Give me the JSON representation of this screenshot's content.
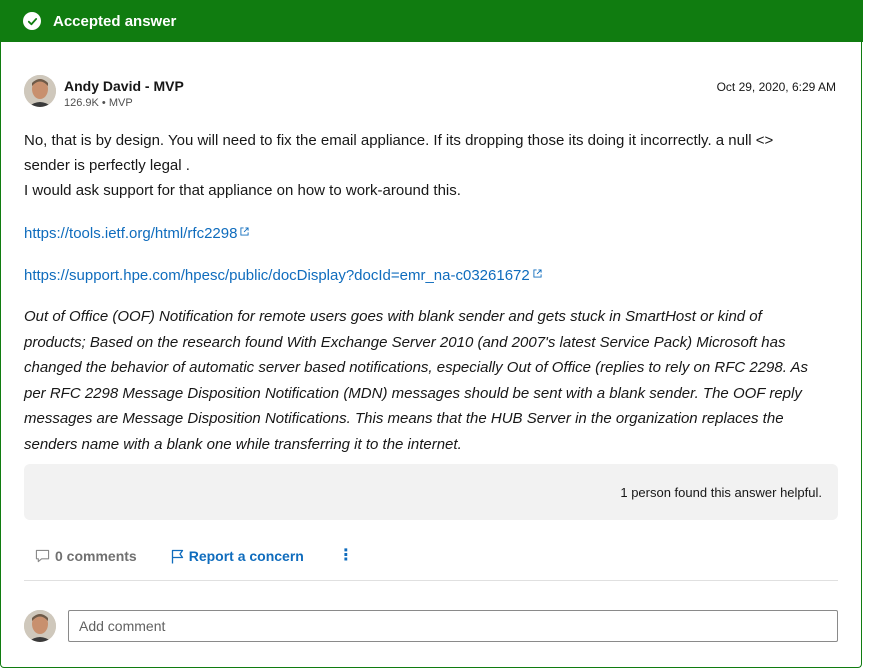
{
  "banner": {
    "title": "Accepted answer"
  },
  "author": {
    "name": "Andy David - MVP",
    "meta": "126.9K • MVP"
  },
  "answer_date": "Oct 29, 2020, 6:29 AM",
  "body": {
    "line1": "No, that is by design. You will need to fix the email appliance. If its dropping those its doing it incorrectly. a null <>",
    "line2": "sender is perfectly legal .",
    "line3": "I would ask support for that appliance on how to work-around this."
  },
  "links": [
    "https://tools.ietf.org/html/rfc2298",
    "https://support.hpe.com/hpesc/public/docDisplay?docId=emr_na-c03261672"
  ],
  "quote": {
    "lines": [
      "Out of Office (OOF) Notification for remote users goes with blank sender and gets stuck in SmartHost or kind of",
      "products; Based on the research found With Exchange Server 2010 (and 2007's latest Service Pack) Microsoft has",
      "changed the behavior of automatic server based notifications, especially Out of Office (replies to rely on RFC 2298. As",
      "per RFC 2298 Message Disposition Notification (MDN) messages should be sent with a blank sender. The OOF reply",
      "messages are Message Disposition Notifications. This means that the HUB Server in the organization replaces the",
      "senders name with a blank one while transferring it to the internet."
    ]
  },
  "helpful_text": "1 person found this answer helpful.",
  "actions": {
    "comments_label": "0 comments",
    "report_label": "Report a concern",
    "more_label": "⋮"
  },
  "comment_box": {
    "placeholder": "Add comment",
    "value": ""
  },
  "icons": {
    "banner": "check-circle-icon",
    "comments": "comment-bubble-icon",
    "report": "flag-icon",
    "external": "external-link-icon"
  },
  "colors": {
    "accent_green": "#107c10",
    "link_blue": "#0f6cbd",
    "helpful_bg": "#f2f2f2"
  }
}
